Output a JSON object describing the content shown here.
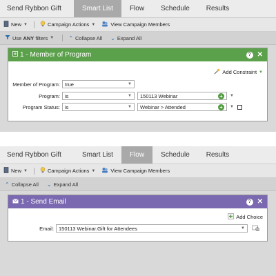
{
  "colors": {
    "smart_list_header": "#5ba04a",
    "flow_header": "#7a68b0",
    "active_tab": "#a9a9a9"
  },
  "top": {
    "tabs": [
      "Send Rybbon Gift",
      "Smart List",
      "Flow",
      "Schedule",
      "Results"
    ],
    "active_tab": "Smart List",
    "toolbar": {
      "new": "New",
      "campaign_actions": "Campaign Actions",
      "view_members": "View Campaign Members"
    },
    "filterbar": {
      "use_prefix": "Use",
      "use_bold": "ANY",
      "use_suffix": "filters",
      "collapse": "Collapse All",
      "expand": "Expand All"
    },
    "card": {
      "title": "1 - Member of Program",
      "add_constraint": "Add Constraint",
      "fields": {
        "member_label": "Member of Program:",
        "member_value": "true",
        "program_label": "Program:",
        "program_op": "is",
        "program_value": "150113 Webinar",
        "status_label": "Program Status:",
        "status_op": "is",
        "status_value": "Webinar > Attended"
      }
    }
  },
  "bottom": {
    "tabs": [
      "Send Rybbon Gift",
      "Smart List",
      "Flow",
      "Schedule",
      "Results"
    ],
    "active_tab": "Flow",
    "toolbar": {
      "new": "New",
      "campaign_actions": "Campaign Actions",
      "view_members": "View Campaign Members"
    },
    "filterbar": {
      "collapse": "Collapse All",
      "expand": "Expand All"
    },
    "card": {
      "title": "1 - Send Email",
      "add_choice": "Add Choice",
      "email_label": "Email:",
      "email_value": "150113 Webinar.Gift for Attendees"
    }
  }
}
